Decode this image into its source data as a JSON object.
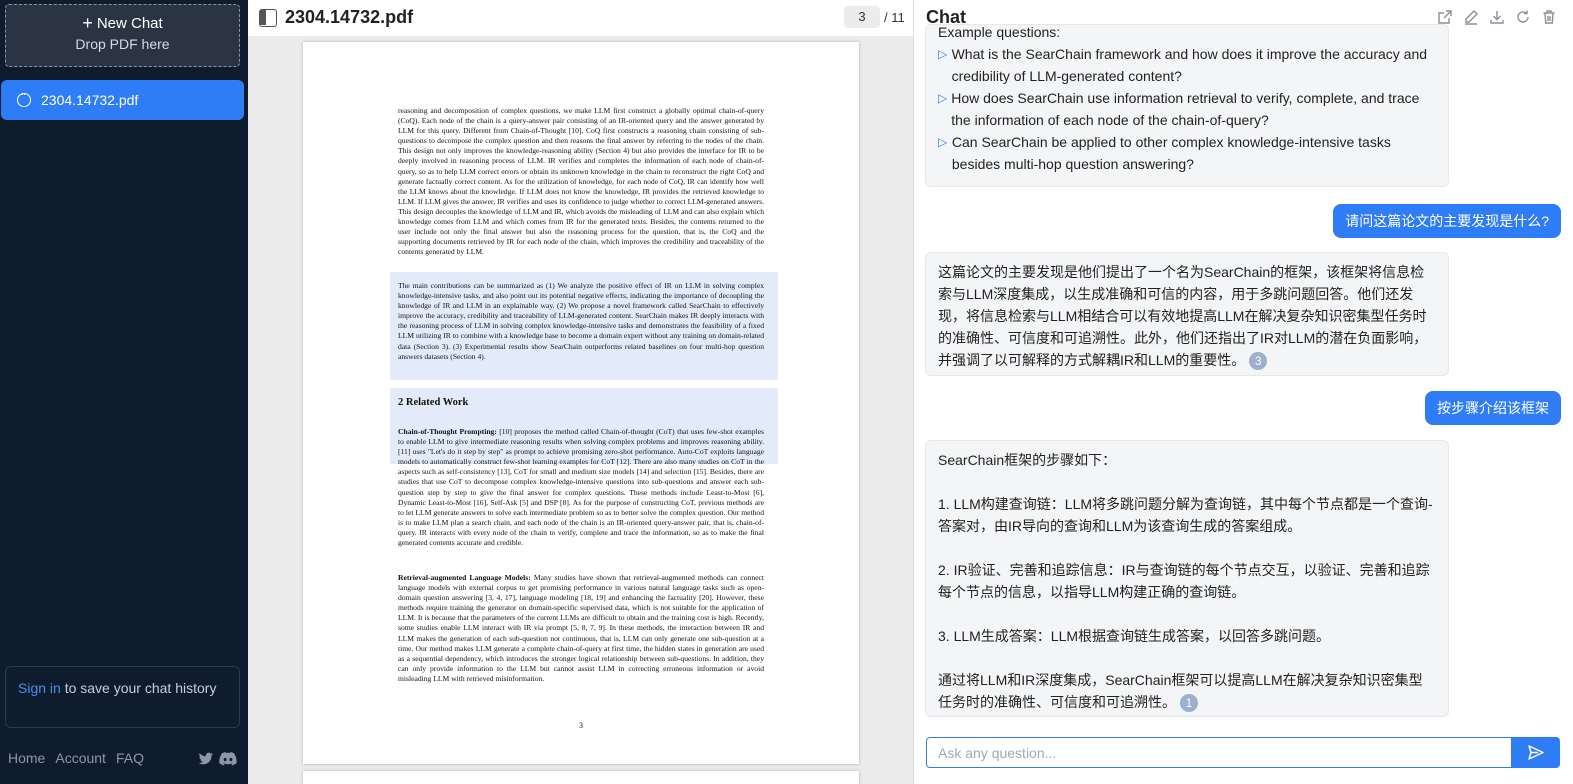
{
  "sidebar": {
    "new_chat_label": "New Chat",
    "drop_label": "Drop PDF here",
    "chats": [
      {
        "label": "2304.14732.pdf"
      }
    ],
    "signin_link": "Sign in",
    "signin_text": " to save your chat history",
    "footer": {
      "home": "Home",
      "account": "Account",
      "faq": "FAQ"
    },
    "social": [
      "twitter-icon",
      "discord-icon"
    ]
  },
  "pdf": {
    "filename": "2304.14732.pdf",
    "current_page": "3",
    "total_pages": "/ 11",
    "page_number_footer": "3",
    "para1": "reasoning and decomposition of complex questions, we make LLM first construct a globally optimal chain-of-query (CoQ). Each node of the chain is a query-answer pair consisting of an IR-oriented query and the answer generated by LLM for this query. Different from Chain-of-Thought [10], CoQ first constructs a reasoning chain consisting of sub-questions to decompose the complex question and then reasons the final answer by referring to the nodes of the chain. This design not only improves the knowledge-reasoning ability (Section 4) but also provides the interface for IR to be deeply involved in reasoning process of LLM. IR verifies and completes the information of each node of chain-of-query, so as to help LLM correct errors or obtain its unknown knowledge in the chain to reconstruct the right CoQ and generate factually correct content. As for the utilization of knowledge, for each node of CoQ, IR can identify how well the LLM knows about the knowledge. If LLM does not know the knowledge, IR provides the retrieved knowledge to LLM. If LLM gives the answer, IR verifies and uses its confidence to judge whether to correct LLM-generated answers. This design decouples the knowledge of LLM and IR, which avoids the misleading of LLM and can also explain which knowledge comes from LLM and which comes from IR for the generated texts. Besides, the contents returned to the user include not only the final answer but also the reasoning process for the question, that is, the CoQ and the supporting documents retrieved by IR for each node of the chain, which improves the credibility and traceability of the contents generated by LLM.",
    "para2": "The main contributions can be summarized as (1) We analyze the positive effect of IR on LLM in solving complex knowledge-intensive tasks, and also point out its potential negative effects, indicating the importance of decoupling the knowledge of IR and LLM in an explainable way. (2) We propose a novel framework called SearChain to effectively improve the accuracy, credibility and traceability of LLM-generated content. SearChain makes IR deeply interacts with the reasoning process of LLM in solving complex knowledge-intensive tasks and demonstrates the feasibility of a fixed LLM utilizing IR to combine with a knowledge base to become a domain expert without any training on domain-related data (Section 3). (3) Experimental results show SearChain outperforms related baselines on four multi-hop question answers datasets (Section 4).",
    "section_title": "2    Related Work",
    "para3_head": "Chain-of-Thought Prompting:",
    "para3": " [10] proposes the method called Chain-of-thought (CoT) that uses few-shot examples to enable LLM to give intermediate reasoning results when solving complex problems and improves reasoning ability. [11] uses \"Let's do it step by step\" as prompt to achieve promising zero-shot performance. Auto-CoT exploits language models to automatically construct few-shot learning examples for CoT [12]. There are also many studies on CoT in the aspects such as self-consistency [13], CoT for small and medium size models [14] and selection [15]. Besides, there are studies that use CoT to decompose complex knowledge-intensive questions into sub-questions and answer each sub-question step by step to give the final answer for complex questions. These methods include Least-to-Most [6], Dynamic Least-to-Most [16], Self-Ask [5] and DSP [8]. As for the purpose of constructing CoT, previous methods are to let LLM generate answers to solve each intermediate problem so as to better solve the complex question. Our method is to make LLM plan a search chain, and each node of the chain is an IR-oriented query-answer pair, that is, chain-of-query. IR interacts with every node of the chain to verify, complete and trace the information, so as to make the final generated contents accurate and credible.",
    "para4_head": "Retrieval-augmented Language Models:",
    "para4": " Many studies have shown that retrieval-augmented methods can connect language models with external corpus to get promising performance in various natural language tasks such as open-domain question answering [3, 4, 17], language modeling [18, 19] and enhancing the factuality [20]. However, these methods require training the generator on domain-specific supervised data, which is not suitable for the application of LLM. It is because that the parameters of the current LLMs are difficult to obtain and the training cost is high. Recently, some studies enable LLM interact with IR via prompt [5, 8, 7, 9]. In these methods, the interaction between IR and LLM makes the generation of each sub-question not continuous, that is, LLM can only generate one sub-question at a time. Our method makes LLM generate a complete chain-of-query at first time, the hidden states in generation are used as a sequential dependency, which introduces the stronger logical relationship between sub-questions. In addition, they can only provide information to the LLM but cannot assist LLM in correcting erroneous information or avoid misleading LLM with retrieved misinformation."
  },
  "chat": {
    "title": "Chat",
    "toolbar_icons": [
      "share-icon",
      "edit-icon",
      "download-icon",
      "refresh-icon",
      "trash-icon"
    ],
    "example_header": "Example questions:",
    "examples": [
      "What is the SearChain framework and how does it improve the accuracy and credibility of LLM-generated content?",
      "How does SearChain use information retrieval to verify, complete, and trace the information of each node of the chain-of-query?",
      "Can SearChain be applied to other complex knowledge-intensive tasks besides multi-hop question answering?"
    ],
    "user_msg_1": "请问这篇论文的主要发现是什么?",
    "ai_msg_1": "这篇论文的主要发现是他们提出了一个名为SearChain的框架，该框架将信息检索与LLM深度集成，以生成准确和可信的内容，用于多跳问题回答。他们还发现，将信息检索与LLM相结合可以有效地提高LLM在解决复杂知识密集型任务时的准确性、可信度和可追溯性。此外，他们还指出了IR对LLM的潜在负面影响，并强调了以可解释的方式解耦IR和LLM的重要性。",
    "ai_msg_1_cite": "3",
    "user_msg_2": "按步骤介绍该框架",
    "ai_msg_2_intro": "SearChain框架的步骤如下：",
    "ai_msg_2_step1": "1. LLM构建查询链：LLM将多跳问题分解为查询链，其中每个节点都是一个查询-答案对，由IR导向的查询和LLM为该查询生成的答案组成。",
    "ai_msg_2_step2": "2. IR验证、完善和追踪信息：IR与查询链的每个节点交互，以验证、完善和追踪每个节点的信息，以指导LLM构建正确的查询链。",
    "ai_msg_2_step3": "3. LLM生成答案：LLM根据查询链生成答案，以回答多跳问题。",
    "ai_msg_2_summary": "通过将LLM和IR深度集成，SearChain框架可以提高LLM在解决复杂知识密集型任务时的准确性、可信度和可追溯性。",
    "ai_msg_2_cite": "1",
    "input_placeholder": "Ask any question..."
  },
  "colors": {
    "accent": "#2f7df6",
    "sidebar_bg": "#0f1c2e",
    "citation_green": "#3cb043",
    "ref_red": "#e33333"
  }
}
